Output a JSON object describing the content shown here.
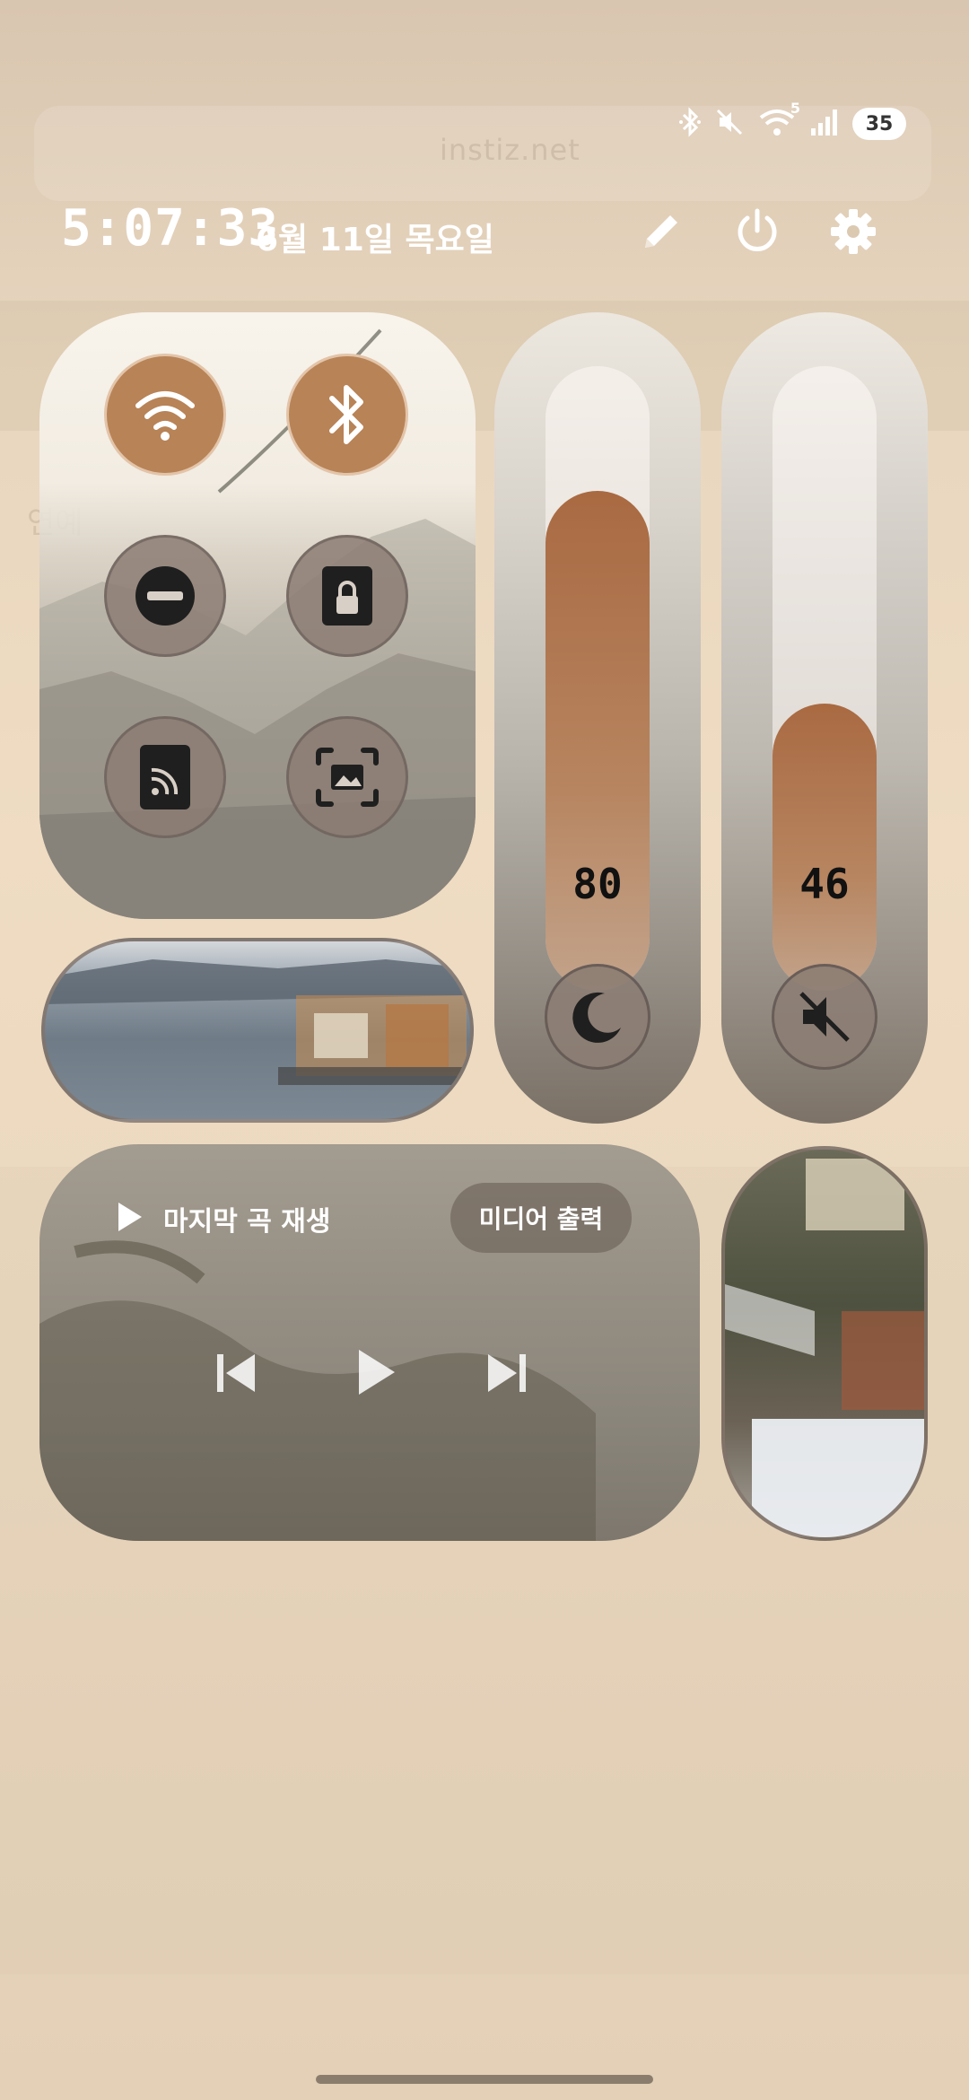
{
  "background": {
    "url": "instiz.net",
    "tab_label": "연예"
  },
  "status_bar": {
    "battery": "35",
    "wifi_badge": "5",
    "icons": [
      "bluetooth-icon",
      "mute-icon",
      "wifi-icon",
      "signal-icon"
    ]
  },
  "header": {
    "time": "5:07:33",
    "date": "6월 11일 목요일",
    "edit_icon": "pencil-icon",
    "power_icon": "power-icon",
    "settings_icon": "gear-icon"
  },
  "quick_toggles": [
    {
      "name": "wifi",
      "icon": "wifi-icon",
      "active": true
    },
    {
      "name": "bluetooth",
      "icon": "bluetooth-icon",
      "active": true
    },
    {
      "name": "do-not-disturb",
      "icon": "minus-circle-icon",
      "active": false
    },
    {
      "name": "rotation-lock",
      "icon": "lock-icon",
      "active": false
    },
    {
      "name": "nfc",
      "icon": "nfc-icon",
      "active": false
    },
    {
      "name": "screenshot",
      "icon": "screenshot-icon",
      "active": false
    }
  ],
  "brightness": {
    "value": "80",
    "level": 0.8,
    "icon": "moon-icon"
  },
  "volume": {
    "value": "46",
    "level": 0.46,
    "icon": "mute-icon"
  },
  "media": {
    "title": "마지막 곡 재생",
    "output_label": "미디어 출력",
    "controls": [
      "previous-icon",
      "play-icon",
      "next-icon"
    ]
  },
  "colors": {
    "accent": "#b88356",
    "idle": "#8c7d73",
    "fill": "#a96a42"
  }
}
